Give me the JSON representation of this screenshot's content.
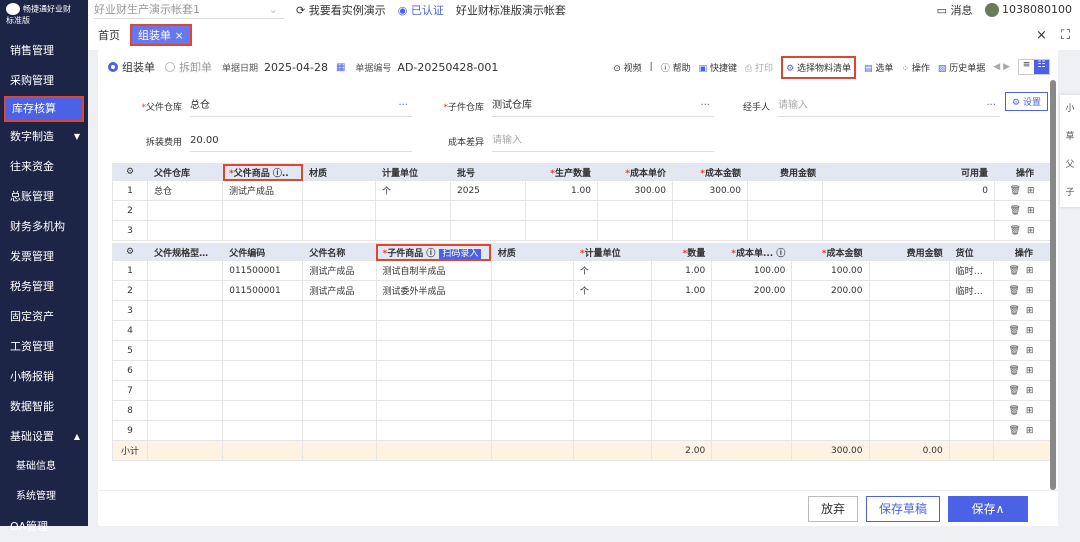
{
  "brand": {
    "name": "畅捷通好业财",
    "edition": "标准版"
  },
  "sidebar": [
    "销售管理",
    "采购管理",
    "库存核算",
    "数字制造",
    "往来资金",
    "总账管理",
    "财务多机构",
    "发票管理",
    "税务管理",
    "固定资产",
    "工资管理",
    "小畅报销",
    "数据智能",
    "基础设置",
    "基础信息",
    "系统管理",
    "OA管理"
  ],
  "topbar": {
    "account": "好业财生产演示帐套1",
    "demo": "我要看实例演示",
    "certified": "已认证",
    "account_name": "好业财标准版演示帐套",
    "messages": "消息",
    "user": "1038080100"
  },
  "tabs": {
    "home": "首页",
    "active": "组装单 ×"
  },
  "toolbar": {
    "radio_assemble": "组装单",
    "radio_disassemble": "拆卸单",
    "date_label": "单据日期",
    "date": "2025-04-28",
    "no_label": "单据编号",
    "no": "AD-20250428-001",
    "video": "视频",
    "help": "帮助",
    "shortcut": "快捷键",
    "print": "打印",
    "select_bom": "选择物料清单",
    "select": "选单",
    "operate": "操作",
    "history": "历史单据"
  },
  "form": {
    "parent_wh_label": "父件仓库",
    "parent_wh": "总仓",
    "child_wh_label": "子件仓库",
    "child_wh": "测试仓库",
    "handler_label": "经手人",
    "handler_ph": "请输入",
    "fee_label": "拆装费用",
    "fee": "20.00",
    "diff_label": "成本差异",
    "diff_ph": "请输入",
    "settings": "设置"
  },
  "table1": {
    "headers": [
      "父件仓库",
      "父件商品",
      "材质",
      "计量单位",
      "批号",
      "生产数量",
      "成本单价",
      "成本金额",
      "费用金额",
      "可用量",
      "操作"
    ],
    "rows": [
      [
        "1",
        "总仓",
        "测试产成品",
        "",
        "个",
        "2025",
        "1.00",
        "300.00",
        "300.00",
        "",
        "0"
      ],
      [
        "2",
        "",
        "",
        "",
        "",
        "",
        "",
        "",
        "",
        "",
        ""
      ],
      [
        "3",
        "",
        "",
        "",
        "",
        "",
        "",
        "",
        "",
        "",
        ""
      ]
    ]
  },
  "table2": {
    "headers": [
      "父件规格型号 ...",
      "父件编码",
      "父件名称",
      "子件商品",
      "材质",
      "计量单位",
      "数量",
      "成本单...",
      "成本金额",
      "费用金额",
      "货位",
      "操作"
    ],
    "scan": "扫码录入",
    "rows": [
      [
        "1",
        "",
        "011500001",
        "测试产成品",
        "测试自制半成品",
        "",
        "个",
        "1.00",
        "100.00",
        "100.00",
        "",
        "临时货位"
      ],
      [
        "2",
        "",
        "011500001",
        "测试产成品",
        "测试委外半成品",
        "",
        "个",
        "1.00",
        "200.00",
        "200.00",
        "",
        "临时货位"
      ],
      [
        "3"
      ],
      [
        "4"
      ],
      [
        "5"
      ],
      [
        "6"
      ],
      [
        "7"
      ],
      [
        "8"
      ],
      [
        "9"
      ]
    ],
    "subtotal": {
      "label": "小计",
      "qty": "2.00",
      "amount": "300.00",
      "fee": "0.00"
    }
  },
  "footer": {
    "discard": "放弃",
    "draft": "保存草稿",
    "save": "保存∧"
  },
  "floatbar": [
    "小",
    "草",
    "父",
    "子"
  ]
}
